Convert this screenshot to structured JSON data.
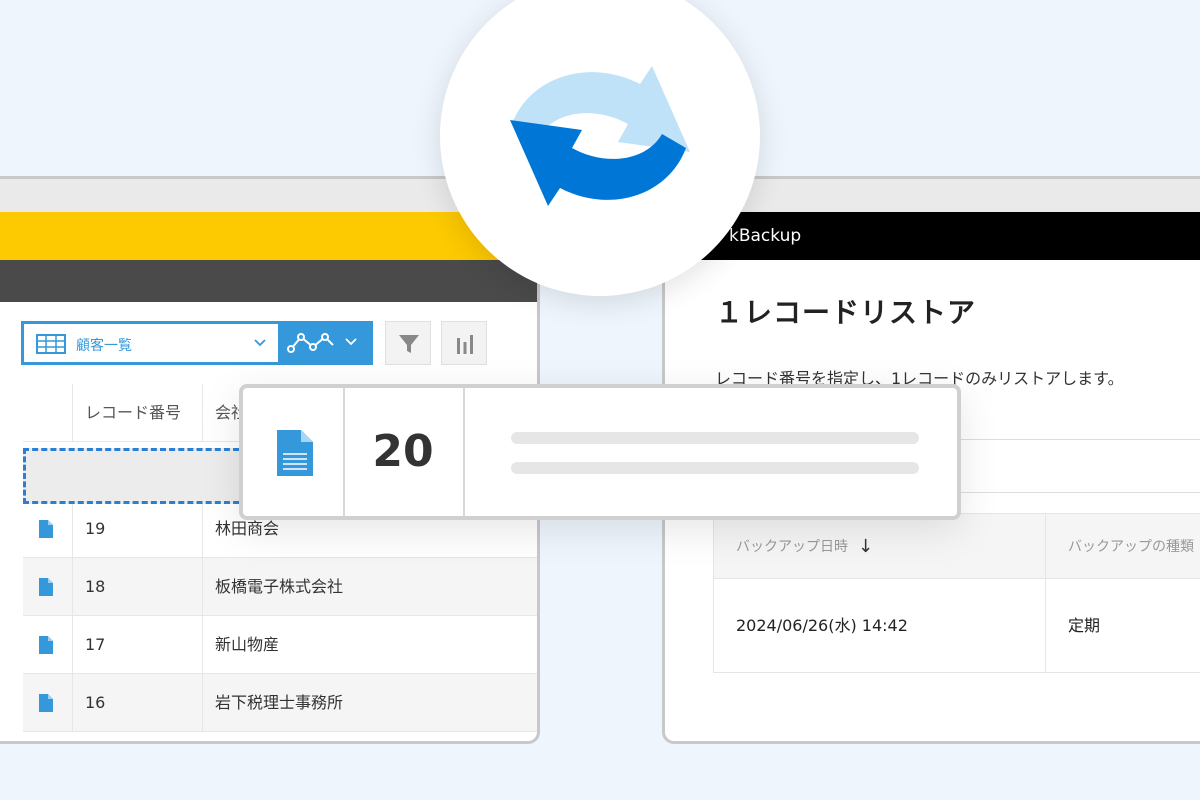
{
  "left_app": {
    "view_selector_label": "顧客一覧",
    "table": {
      "headers": [
        "",
        "レコード番号",
        "会社"
      ],
      "rows": [
        {
          "number": "19",
          "company": "林田商会"
        },
        {
          "number": "18",
          "company": "板橋電子株式会社"
        },
        {
          "number": "17",
          "company": "新山物産"
        },
        {
          "number": "16",
          "company": "岩下税理士事務所"
        }
      ]
    }
  },
  "floating_card": {
    "record_number": "20"
  },
  "right_app": {
    "brand": "kBackup",
    "page_title": "１レコードリストア",
    "description": "レコード番号を指定し、1レコードのみリストアします。",
    "table": {
      "headers": [
        "バックアップ日時",
        "バックアップの種類"
      ],
      "row": {
        "datetime": "2024/06/26(水) 14:42",
        "type": "定期"
      }
    }
  },
  "colors": {
    "accent_blue": "#3498db",
    "kintone_yellow": "#fdc900",
    "sync_dark_blue": "#0076d7",
    "sync_light_blue": "#bfe2f8"
  }
}
